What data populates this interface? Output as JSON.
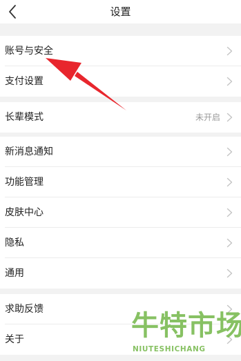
{
  "header": {
    "title": "设置",
    "back_icon": "chevron-left-icon"
  },
  "groups": [
    {
      "rows": [
        {
          "label": "账号与安全"
        },
        {
          "label": "支付设置"
        }
      ]
    },
    {
      "rows": [
        {
          "label": "长辈模式",
          "value": "未开启"
        }
      ]
    },
    {
      "rows": [
        {
          "label": "新消息通知"
        },
        {
          "label": "功能管理"
        },
        {
          "label": "皮肤中心"
        },
        {
          "label": "隐私"
        },
        {
          "label": "通用"
        }
      ]
    },
    {
      "rows": [
        {
          "label": "求助反馈"
        },
        {
          "label": "关于"
        }
      ]
    }
  ],
  "annotation": {
    "arrow_color": "#e8262d",
    "points_to": "账号与安全"
  },
  "watermark": {
    "text_cn": "牛特市场",
    "text_en": "NIUTESHICHANG",
    "color": "#76b84d"
  }
}
